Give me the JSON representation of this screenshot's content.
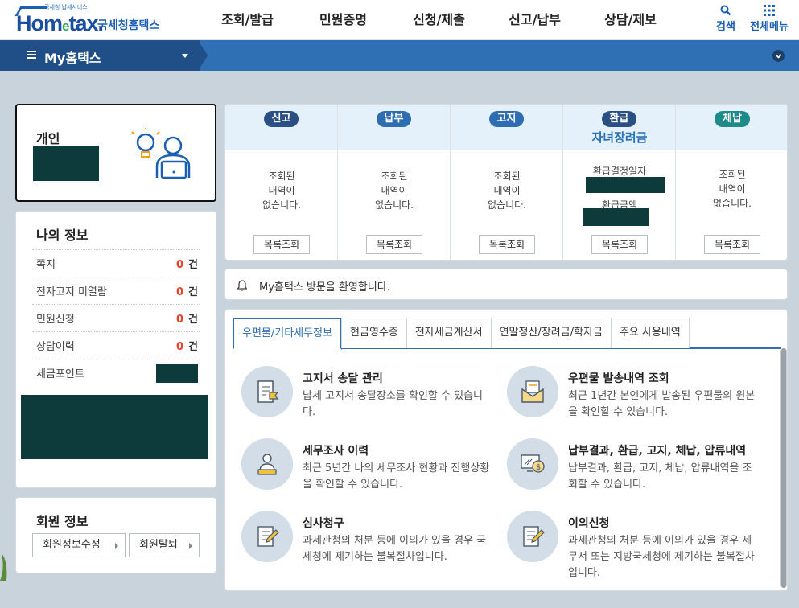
{
  "header": {
    "logo_tagline": "국세청 납세서비스",
    "logo_brand_a": "Hom",
    "logo_brand_e": "e",
    "logo_brand_b": "tax.",
    "logo_korean": "국세청홈택스",
    "nav": [
      "조회/발급",
      "민원증명",
      "신청/제출",
      "신고/납부",
      "상담/제보"
    ],
    "search_label": "검색",
    "menu_label": "전체메뉴"
  },
  "subbar": {
    "title": "My홈택스"
  },
  "personal": {
    "label": "개인"
  },
  "myinfo": {
    "title": "나의 정보",
    "rows": [
      {
        "label": "쪽지",
        "count": "0",
        "unit": "건"
      },
      {
        "label": "전자고지 미열람",
        "count": "0",
        "unit": "건"
      },
      {
        "label": "민원신청",
        "count": "0",
        "unit": "건"
      },
      {
        "label": "상담이력",
        "count": "0",
        "unit": "건"
      }
    ],
    "points_label": "세금포인트"
  },
  "member": {
    "title": "회원 정보",
    "edit_button": "회원정보수정",
    "leave_button": "회원탈퇴"
  },
  "status": {
    "columns": [
      {
        "badge": "신고",
        "message": [
          "조회된",
          "내역이",
          "없습니다."
        ],
        "button": "목록조회",
        "color": "#2b4f83"
      },
      {
        "badge": "납부",
        "message": [
          "조회된",
          "내역이",
          "없습니다."
        ],
        "button": "목록조회",
        "color": "#2f6db3"
      },
      {
        "badge": "고지",
        "message": [
          "조회된",
          "내역이",
          "없습니다."
        ],
        "button": "목록조회",
        "color": "#2f6db3"
      },
      {
        "badge": "환급",
        "subtitle": "자녀장려금",
        "refund_date_label": "환급결정일자",
        "refund_amount_label": "환급금액",
        "button": "목록조회",
        "color": "#2b4f83"
      },
      {
        "badge": "체납",
        "message": [
          "조회된",
          "내역이",
          "없습니다."
        ],
        "button": "목록조회",
        "color": "#1f8a8a"
      }
    ]
  },
  "welcome": {
    "text": "My홈택스 방문을 환영합니다."
  },
  "tabs": {
    "items": [
      "우편물/기타세무정보",
      "현금영수증",
      "전자세금계산서",
      "연말정산/장려금/학자금",
      "주요 사용내역"
    ],
    "active_index": 0
  },
  "services": [
    {
      "title": "고지서 송달 관리",
      "desc": "납세 고지서 송달장소를 확인할 수 있습니다.",
      "icon": "document-flag-icon"
    },
    {
      "title": "우편물 발송내역 조회",
      "desc": "최근 1년간 본인에게 발송된 우편물의 원본을 확인할 수 있습니다.",
      "icon": "envelope-icon"
    },
    {
      "title": "세무조사 이력",
      "desc": "최근 5년간 나의 세무조사 현황과 진행상황을 확인할 수 있습니다.",
      "icon": "person-laptop-icon"
    },
    {
      "title": "납부결과, 환급, 고지, 체납, 압류내역",
      "desc": "납부결과, 환급, 고지, 체납, 압류내역을 조회할 수 있습니다.",
      "icon": "monitor-coin-icon"
    },
    {
      "title": "심사청구",
      "desc": "과세관청의 처분 등에 이의가 있을 경우 국세청에 제기하는 불복절차입니다.",
      "icon": "document-pen-icon"
    },
    {
      "title": "이의신청",
      "desc": "과세관청의 처분 등에 이의가 있을 경우 세무서 또는 지방국세청에 제기하는 불복절차입니다.",
      "icon": "document-pen-icon"
    }
  ],
  "colors": {
    "brand": "#1a5fb4",
    "subbar": "#2f6fb3",
    "subbar_dark": "#1f4f86",
    "count_red": "#e3412b",
    "redaction": "#0d3b3b"
  }
}
